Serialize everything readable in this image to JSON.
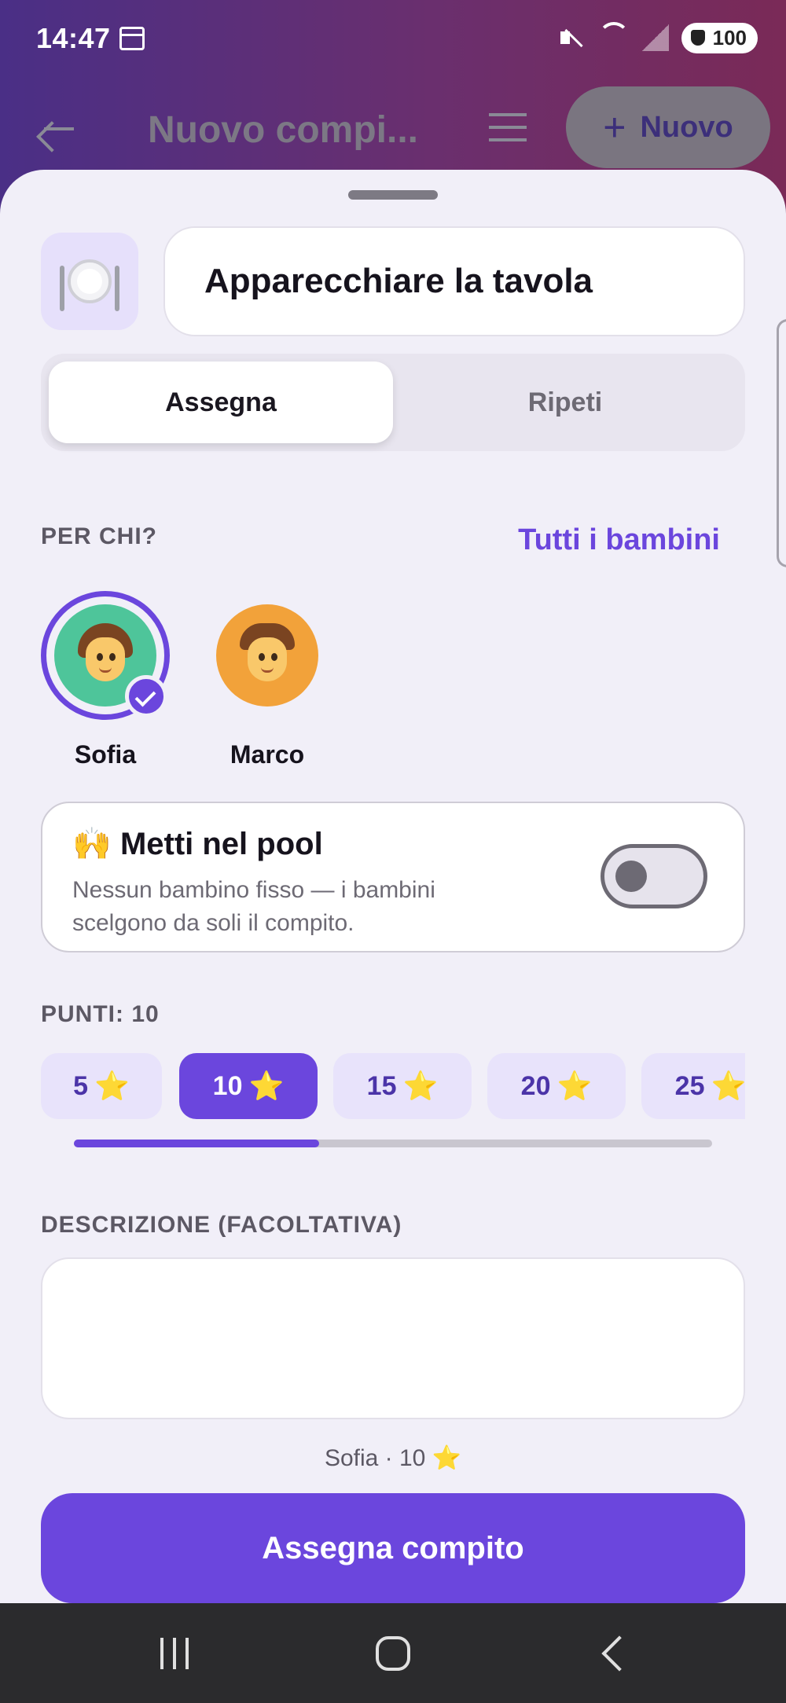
{
  "status_bar": {
    "time": "14:47",
    "battery": "100"
  },
  "topbar": {
    "title": "Nuovo compi...",
    "new_label": "Nuovo"
  },
  "task": {
    "icon": "plate-cutlery-icon",
    "title": "Apparecchiare la tavola"
  },
  "tabs": [
    {
      "label": "Assegna",
      "active": true
    },
    {
      "label": "Ripeti",
      "active": false
    }
  ],
  "assign": {
    "for_label": "PER CHI?",
    "all_children_link": "Tutti i bambini",
    "children": [
      {
        "name": "Sofia",
        "selected": true,
        "color": "#4ec59a"
      },
      {
        "name": "Marco",
        "selected": false,
        "color": "#f2a23a"
      }
    ]
  },
  "pool": {
    "emoji": "🙌",
    "title": "Metti nel pool",
    "description": "Nessun bambino fisso — i bambini scelgono da soli il compito.",
    "enabled": false
  },
  "points": {
    "label": "PUNTI: 10",
    "options": [
      {
        "label": "5",
        "selected": false
      },
      {
        "label": "10",
        "selected": true
      },
      {
        "label": "15",
        "selected": false
      },
      {
        "label": "20",
        "selected": false
      },
      {
        "label": "25",
        "selected": false
      }
    ],
    "star": "⭐"
  },
  "description": {
    "label": "DESCRIZIONE (FACOLTATIVA)",
    "value": ""
  },
  "summary": "Sofia · 10 ⭐",
  "submit_label": "Assegna compito",
  "colors": {
    "accent": "#6b46dd",
    "background": "#f1eff8"
  }
}
